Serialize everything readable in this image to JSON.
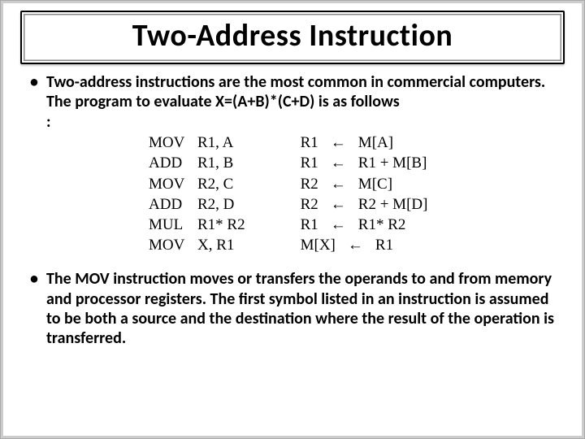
{
  "title": "Two-Address Instruction",
  "bullets": {
    "b1_part1": "Two-address instructions are the most common in commercial computers. The program to evaluate X=(A+B)*(C+D) is as follows",
    "b1_part2": ":",
    "b2": "The MOV instruction moves or transfers the operands to and from memory and processor registers. The first symbol listed in an instruction is assumed to be both a source and the destination where the result of the operation is transferred."
  },
  "code": {
    "left": [
      {
        "mn": "MOV",
        "ops": "R1, A"
      },
      {
        "mn": "ADD",
        "ops": "R1, B"
      },
      {
        "mn": "MOV",
        "ops": "R2, C"
      },
      {
        "mn": "ADD",
        "ops": "R2, D"
      },
      {
        "mn": "MUL",
        "ops": "R1* R2"
      },
      {
        "mn": "MOV",
        "ops": "X, R1"
      }
    ],
    "right": [
      {
        "dst": "R1",
        "src": "M[A]"
      },
      {
        "dst": "R1",
        "src": "R1 + M[B]"
      },
      {
        "dst": "R2",
        "src": "M[C]"
      },
      {
        "dst": "R2",
        "src": "R2 + M[D]"
      },
      {
        "dst": "R1",
        "src": "R1* R2"
      },
      {
        "dst": "M[X]",
        "src": "R1"
      }
    ],
    "arrow": "←"
  }
}
